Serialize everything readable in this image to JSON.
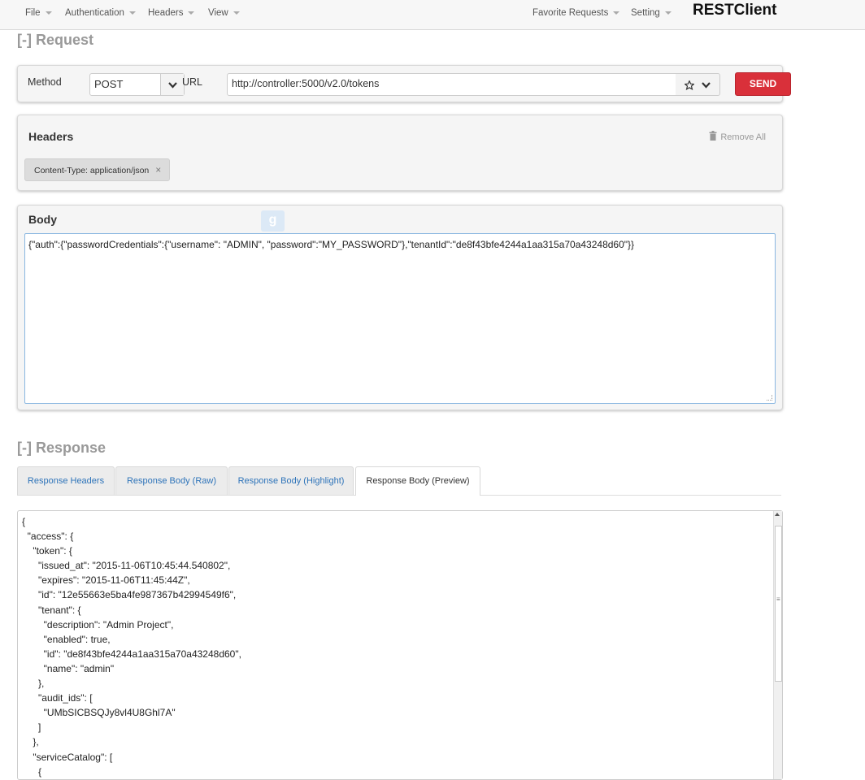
{
  "menu": {
    "file": "File",
    "authentication": "Authentication",
    "headers": "Headers",
    "view": "View",
    "favorite_requests": "Favorite Requests",
    "setting": "Setting",
    "brand": "RESTClient"
  },
  "request": {
    "section_bracket": "[-]",
    "section_title": "Request",
    "method_label": "Method",
    "method_value": "POST",
    "url_label": "URL",
    "url_value": "http://controller:5000/v2.0/tokens",
    "send_label": "SEND"
  },
  "headers": {
    "title": "Headers",
    "remove_all": "Remove All",
    "items": [
      {
        "label": "Content-Type: application/json",
        "close": "×"
      }
    ]
  },
  "body": {
    "title": "Body",
    "badge": "g",
    "content": "{\"auth\":{\"passwordCredentials\":{\"username\": \"ADMIN\", \"password\":\"MY_PASSWORD\"},\"tenantId\":\"de8f43bfe4244a1aa315a70a43248d60\"}}"
  },
  "response": {
    "section_bracket": "[-]",
    "section_title": "Response",
    "tabs": [
      {
        "label": "Response Headers",
        "active": false
      },
      {
        "label": "Response Body (Raw)",
        "active": false
      },
      {
        "label": "Response Body (Highlight)",
        "active": false
      },
      {
        "label": "Response Body (Preview)",
        "active": true
      }
    ],
    "lines": [
      "{",
      "  \"access\": {",
      "    \"token\": {",
      "      \"issued_at\": \"2015-11-06T10:45:44.540802\",",
      "      \"expires\": \"2015-11-06T11:45:44Z\",",
      "      \"id\": \"12e55663e5ba4fe987367b42994549f6\",",
      "      \"tenant\": {",
      "        \"description\": \"Admin Project\",",
      "        \"enabled\": true,",
      "        \"id\": \"de8f43bfe4244a1aa315a70a43248d60\",",
      "        \"name\": \"admin\"",
      "      },",
      "      \"audit_ids\": [",
      "        \"UMbSICBSQJy8vl4U8Ghl7A\"",
      "      ]",
      "    },",
      "    \"serviceCatalog\": [",
      "      {"
    ]
  },
  "colors": {
    "send": "#d9303a",
    "link_tab": "#2d73b9",
    "focus_border": "#8ab7e1"
  }
}
